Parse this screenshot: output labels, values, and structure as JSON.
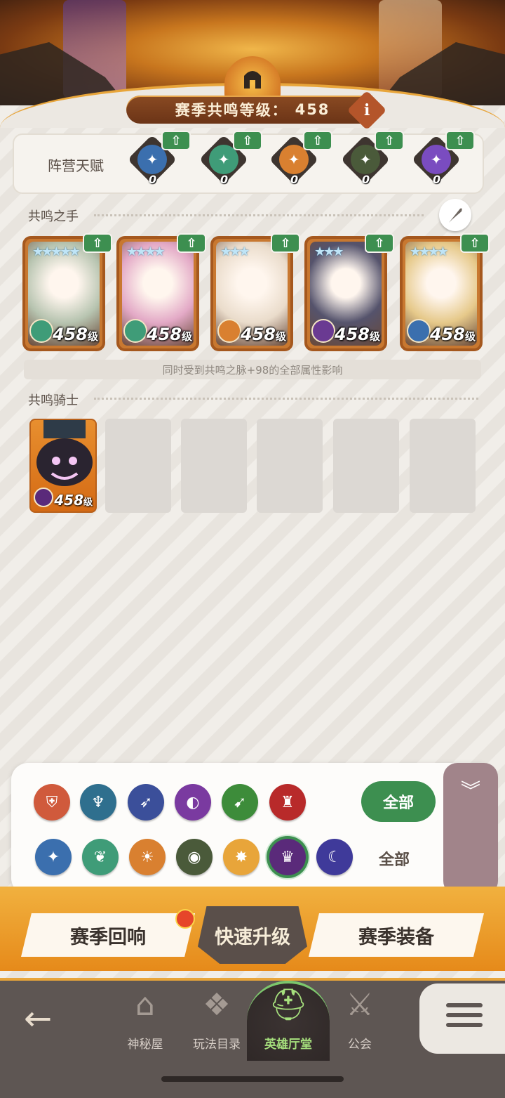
{
  "header": {
    "season_label": "赛季共鸣等级：",
    "season_level": "458",
    "info_symbol": "i"
  },
  "faction_talents": {
    "title": "阵营天赋",
    "items": [
      {
        "icon": "star-compass-icon",
        "color": "#3b6fae",
        "count": "0"
      },
      {
        "icon": "leaf-icon",
        "color": "#3f9c78",
        "count": "0"
      },
      {
        "icon": "sun-icon",
        "color": "#d98030",
        "count": "0"
      },
      {
        "icon": "eye-icon",
        "color": "#4a5a3a",
        "count": "0"
      },
      {
        "icon": "crescent-star-icon",
        "color": "#7a4cc0",
        "count": "0"
      }
    ]
  },
  "resonance_hands": {
    "title": "共鸣之手",
    "note": "同时受到共鸣之脉+98的全部属性影响",
    "cards": [
      {
        "level": "458",
        "unit": "级",
        "stars": "★★★★★",
        "portrait": "#b7c4b0",
        "faction": "#3f9c78"
      },
      {
        "level": "458",
        "unit": "级",
        "stars": "★★★★",
        "portrait": "#e3a9c6",
        "faction": "#3f9c78"
      },
      {
        "level": "458",
        "unit": "级",
        "stars": "★★★",
        "portrait": "#eadccb",
        "faction": "#d98030"
      },
      {
        "level": "458",
        "unit": "级",
        "stars": "★★★",
        "portrait": "#55536c",
        "faction": "#6a3a92"
      },
      {
        "level": "458",
        "unit": "级",
        "stars": "★★★★",
        "portrait": "#e6c98a",
        "faction": "#3b6fae"
      }
    ]
  },
  "resonance_knights": {
    "title": "共鸣骑士",
    "knight": {
      "level": "458",
      "unit": "级"
    }
  },
  "filter": {
    "all_primary": "全部",
    "all_secondary": "全部",
    "classes": [
      {
        "icon": "shield-icon",
        "color": "#d05a3c",
        "glyph": "⛨"
      },
      {
        "icon": "mystic-icon",
        "color": "#2f6f8e",
        "glyph": "♆"
      },
      {
        "icon": "bow-icon",
        "color": "#3b4f9a",
        "glyph": "➶"
      },
      {
        "icon": "magic-icon",
        "color": "#7a3aa0",
        "glyph": "◐"
      },
      {
        "icon": "dagger-icon",
        "color": "#3d8c3a",
        "glyph": "➹"
      },
      {
        "icon": "warrior-icon",
        "color": "#b82a2a",
        "glyph": "♜"
      }
    ],
    "factions": [
      {
        "icon": "star-compass-icon",
        "color": "#3b6fae",
        "glyph": "✦"
      },
      {
        "icon": "leaf-icon",
        "color": "#3f9c78",
        "glyph": "❦"
      },
      {
        "icon": "sun-icon",
        "color": "#d98030",
        "glyph": "☀"
      },
      {
        "icon": "eye-icon",
        "color": "#4a5a3a",
        "glyph": "◉"
      },
      {
        "icon": "radiant-icon",
        "color": "#e8a53a",
        "glyph": "✸"
      },
      {
        "icon": "demon-icon",
        "color": "#5a2a7a",
        "glyph": "♛"
      },
      {
        "icon": "crescent-star-icon",
        "color": "#3f3a9a",
        "glyph": "☾"
      }
    ]
  },
  "actions": {
    "left": "赛季回响",
    "middle": "快速升级",
    "right": "赛季装备"
  },
  "nav": {
    "items": [
      {
        "label": "神秘屋",
        "icon": "mystery-house-icon"
      },
      {
        "label": "玩法目录",
        "icon": "gameplay-catalog-icon"
      },
      {
        "label": "英雄厅堂",
        "icon": "hero-hall-icon"
      },
      {
        "label": "公会",
        "icon": "guild-icon"
      }
    ]
  }
}
